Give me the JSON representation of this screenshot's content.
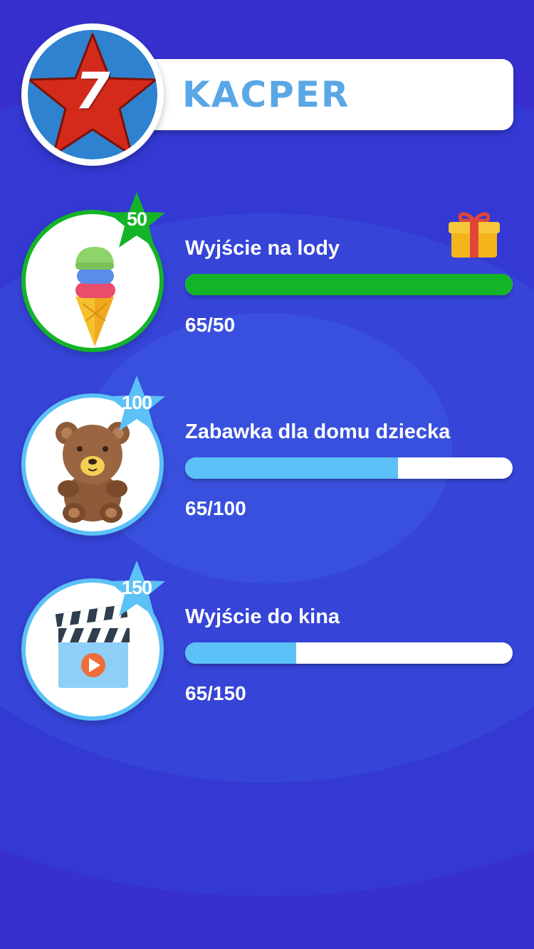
{
  "profile": {
    "name": "KACPER",
    "level": "7"
  },
  "rewards": [
    {
      "title": "Wyjście na lody",
      "cost": "50",
      "progress_text": "65/50",
      "progress_fraction": 1.0,
      "icon": "ice-cream-icon",
      "status": "unlocked",
      "bar_color": "#13b428",
      "ring_color": "#13b428"
    },
    {
      "title": "Zabawka dla domu dziecka",
      "cost": "100",
      "progress_text": "65/100",
      "progress_fraction": 0.65,
      "icon": "teddy-bear-icon",
      "status": "locked",
      "bar_color": "#5cc1f6",
      "ring_color": "#5cc1f6"
    },
    {
      "title": "Wyjście do kina",
      "cost": "150",
      "progress_text": "65/150",
      "progress_fraction": 0.34,
      "icon": "clapperboard-icon",
      "status": "locked",
      "bar_color": "#5cc1f6",
      "ring_color": "#5cc1f6"
    }
  ],
  "colors": {
    "background": "#3730cf",
    "level_star": "#d42a1c",
    "level_circle": "#2f82cf",
    "name_text": "#5aa7e6",
    "done_green": "#13b428",
    "pending_blue": "#5cc1f6"
  }
}
